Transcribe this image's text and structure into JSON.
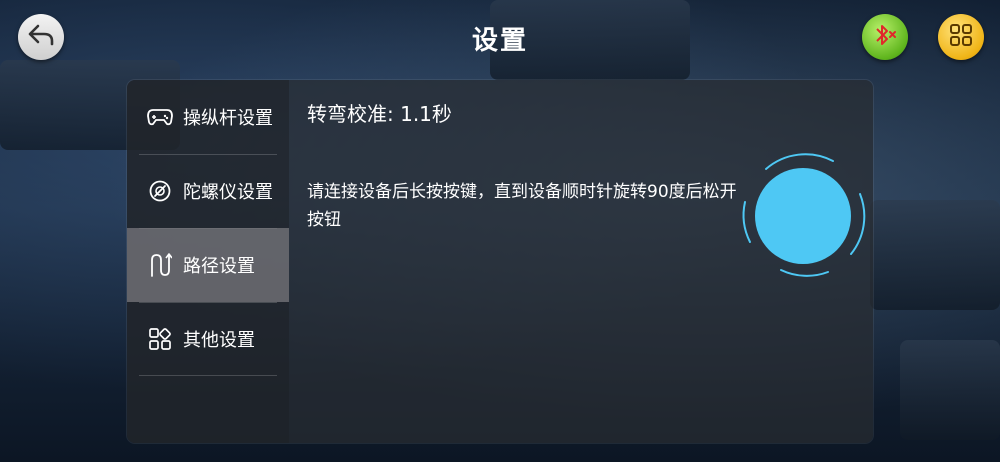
{
  "header": {
    "title": "设置",
    "back_icon": "back-arrow-icon",
    "bluetooth_icon": "bluetooth-disconnected-icon",
    "menu_icon": "grid-menu-icon"
  },
  "sidebar": {
    "items": [
      {
        "label": "操纵杆设置",
        "icon": "gamepad-icon"
      },
      {
        "label": "陀螺仪设置",
        "icon": "gyroscope-icon"
      },
      {
        "label": "路径设置",
        "icon": "path-icon"
      },
      {
        "label": "其他设置",
        "icon": "apps-icon"
      }
    ],
    "active_index": 2
  },
  "content": {
    "calibration": "转弯校准: 1.1秒",
    "instruction": "请连接设备后长按按键，直到设备顺时针旋转90度后松开按钮"
  },
  "colors": {
    "accent": "#4ec8f4",
    "bluetooth_button": "#6cc22a",
    "menu_button": "#f2b81a",
    "active_item": "#78787d"
  }
}
